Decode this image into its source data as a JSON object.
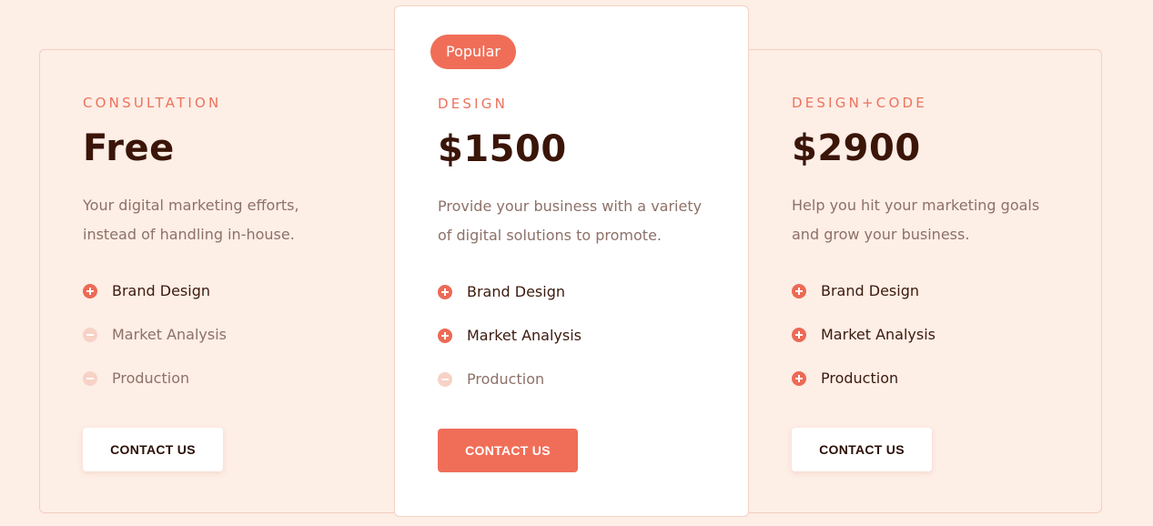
{
  "plans": [
    {
      "tier": "CONSULTATION",
      "price": "Free",
      "description": "Your digital marketing efforts, instead of handling in-house.",
      "features": [
        {
          "label": "Brand Design",
          "included": true,
          "icon": "plus-circle-icon"
        },
        {
          "label": "Market Analysis",
          "included": false,
          "icon": "minus-circle-icon"
        },
        {
          "label": "Production",
          "included": false,
          "icon": "minus-circle-icon"
        }
      ],
      "button_label": "CONTACT US"
    },
    {
      "badge": "Popular",
      "tier": "DESIGN",
      "price": "$1500",
      "description": "Provide your business with a variety of digital solutions to promote.",
      "features": [
        {
          "label": "Brand Design",
          "included": true,
          "icon": "plus-circle-icon"
        },
        {
          "label": "Market Analysis",
          "included": true,
          "icon": "plus-circle-icon"
        },
        {
          "label": "Production",
          "included": false,
          "icon": "minus-circle-icon"
        }
      ],
      "button_label": "CONTACT US"
    },
    {
      "tier": "DESIGN+CODE",
      "price": "$2900",
      "description": "Help you hit your marketing goals and grow your business.",
      "features": [
        {
          "label": "Brand Design",
          "included": true,
          "icon": "plus-circle-icon"
        },
        {
          "label": "Market Analysis",
          "included": true,
          "icon": "plus-circle-icon"
        },
        {
          "label": "Production",
          "included": true,
          "icon": "plus-circle-icon"
        }
      ],
      "button_label": "CONTACT US"
    }
  ],
  "colors": {
    "background": "#fdeee6",
    "accent": "#f06e58",
    "heading": "#3a1508",
    "muted_text": "#8d7168",
    "card": "#ffffff"
  }
}
